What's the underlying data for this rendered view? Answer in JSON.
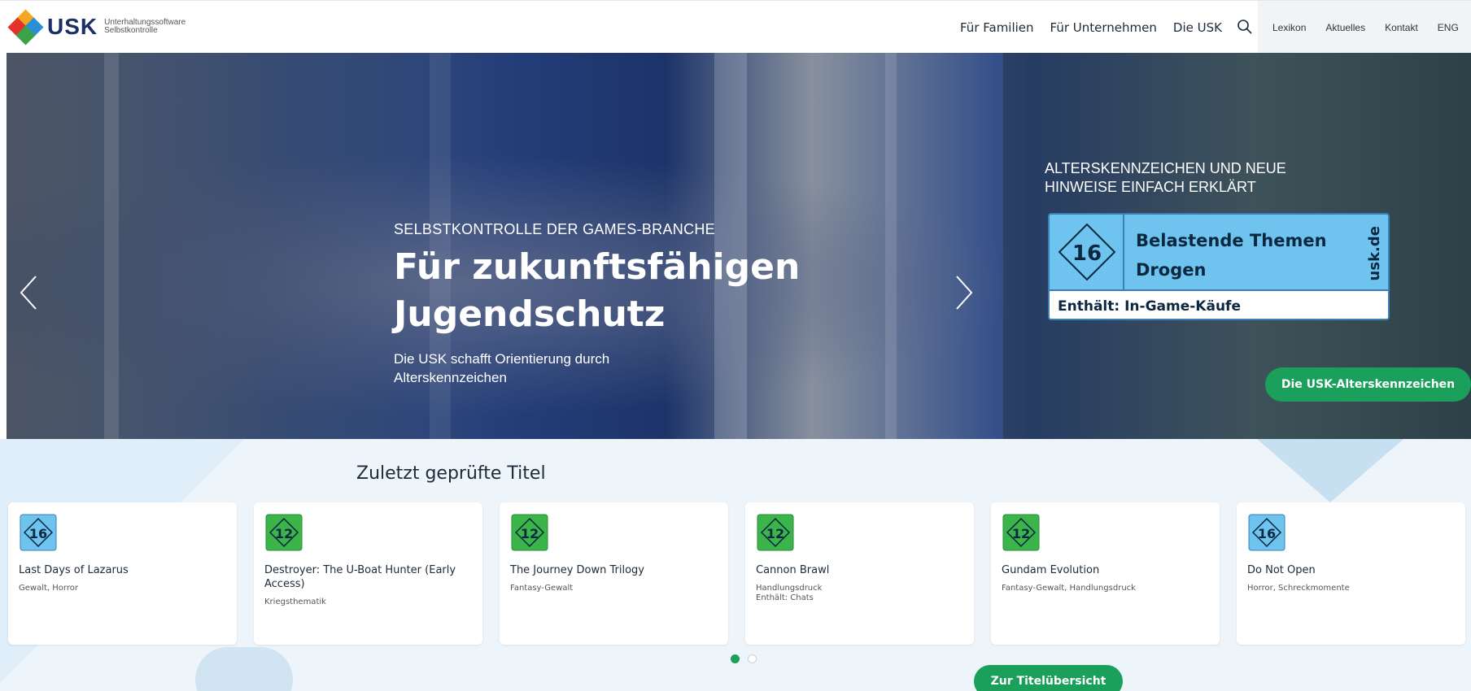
{
  "header": {
    "logo_text": "USK",
    "logo_sub_1": "Unterhaltungssoftware",
    "logo_sub_2": "Selbstkontrolle",
    "main_nav": [
      "Für Familien",
      "Für Unternehmen",
      "Die USK"
    ],
    "sub_nav": [
      "Lexikon",
      "Aktuelles",
      "Kontakt",
      "ENG"
    ]
  },
  "hero": {
    "kicker": "SELBSTKONTROLLE DER GAMES-BRANCHE",
    "title": "Für zukunftsfähigen Jugendschutz",
    "text": "Die USK schafft Orientierung durch Alterskennzeichen",
    "overlay_title": "ALTERSKENNZEICHEN UND NEUE HINWEISE EINFACH ERKLÄRT",
    "label": {
      "age": "16",
      "line1": "Belastende Themen",
      "line2": "Drogen",
      "side": "usk.de",
      "footer": "Enthält: In-Game-Käufe"
    },
    "cta": "Die USK-Alterskennzeichen"
  },
  "recent": {
    "title": "Zuletzt geprüfte Titel",
    "cards": [
      {
        "age": "16",
        "title": "Last Days of Lazarus",
        "desc": "Gewalt, Horror",
        "desc2": ""
      },
      {
        "age": "12",
        "title": "Destroyer: The U-Boat Hunter (Early Access)",
        "desc": "Kriegsthematik",
        "desc2": ""
      },
      {
        "age": "12",
        "title": "The Journey Down Trilogy",
        "desc": "Fantasy-Gewalt",
        "desc2": ""
      },
      {
        "age": "12",
        "title": "Cannon Brawl",
        "desc": "Handlungsdruck",
        "desc2": "Enthält: Chats"
      },
      {
        "age": "12",
        "title": "Gundam Evolution",
        "desc": "Fantasy-Gewalt, Handlungsdruck",
        "desc2": ""
      },
      {
        "age": "16",
        "title": "Do Not Open",
        "desc": "Horror, Schreckmomente",
        "desc2": ""
      }
    ],
    "cta": "Zur Titelübersicht"
  },
  "colors": {
    "green_cta": "#1aa05a",
    "usk16_blue": "#6ec4ee",
    "usk12_green": "#3bb54a"
  }
}
